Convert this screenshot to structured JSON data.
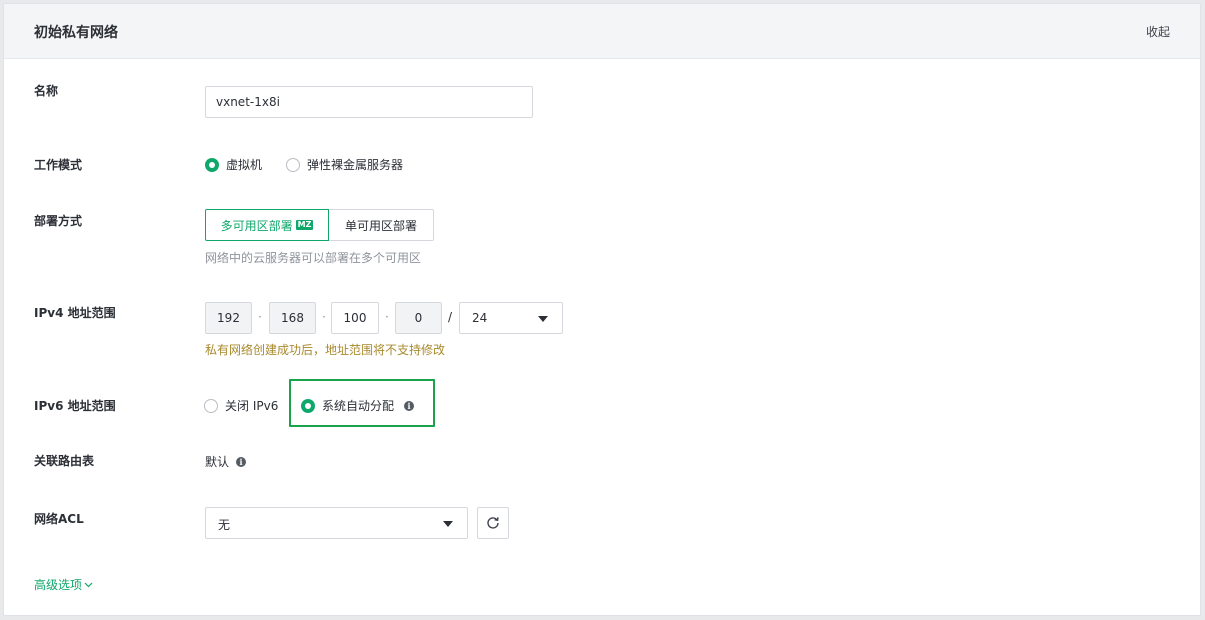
{
  "header": {
    "title": "初始私有网络",
    "collapse_label": "收起"
  },
  "name_field": {
    "label": "名称",
    "value": "vxnet-1x8i"
  },
  "work_mode": {
    "label": "工作模式",
    "options": [
      {
        "label": "虚拟机",
        "checked": true
      },
      {
        "label": "弹性裸金属服务器",
        "checked": false
      }
    ]
  },
  "deploy": {
    "label": "部署方式",
    "options": [
      {
        "label": "多可用区部署",
        "badge": "MZ",
        "active": true
      },
      {
        "label": "单可用区部署",
        "active": false
      }
    ],
    "hint": "网络中的云服务器可以部署在多个可用区"
  },
  "ipv4": {
    "label": "IPv4 地址范围",
    "octets": [
      "192",
      "168",
      "100",
      "0"
    ],
    "separator": "·",
    "slash": "/",
    "prefix": "24",
    "warning": "私有网络创建成功后，地址范围将不支持修改"
  },
  "ipv6": {
    "label": "IPv6 地址范围",
    "options": [
      {
        "label": "关闭 IPv6",
        "checked": false
      },
      {
        "label": "系统自动分配",
        "checked": true
      }
    ],
    "info_icon": "info-icon"
  },
  "route_table": {
    "label": "关联路由表",
    "value": "默认",
    "info_icon": "info-icon"
  },
  "acl": {
    "label": "网络ACL",
    "value": "无",
    "refresh_icon": "refresh-icon"
  },
  "advanced": {
    "label": "高级选项",
    "icon": "chevron-down-icon"
  },
  "colors": {
    "accent": "#0fa86a",
    "highlight_border": "#1aa34a",
    "warning": "#a8892d"
  }
}
